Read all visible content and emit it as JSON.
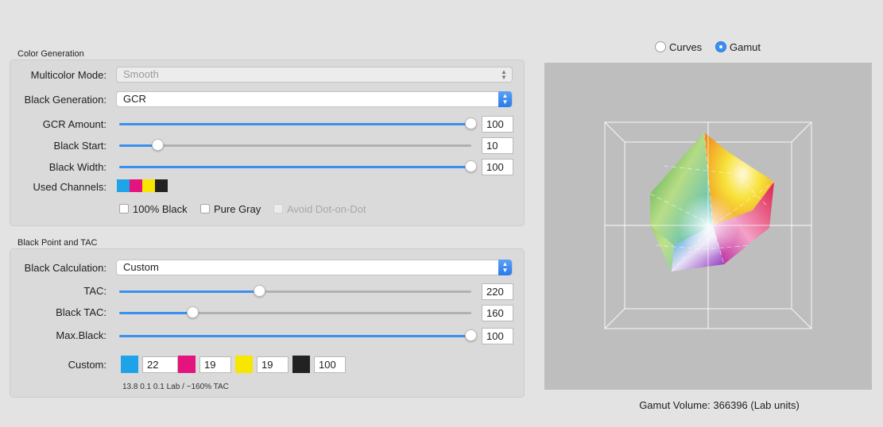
{
  "color_generation": {
    "title": "Color Generation",
    "multicolor_mode": {
      "label": "Multicolor Mode:",
      "value": "Smooth"
    },
    "black_generation": {
      "label": "Black Generation:",
      "value": "GCR"
    },
    "gcr_amount": {
      "label": "GCR Amount:",
      "value": "100",
      "fraction": 1.0
    },
    "black_start": {
      "label": "Black Start:",
      "value": "10",
      "fraction": 0.11
    },
    "black_width": {
      "label": "Black Width:",
      "value": "100",
      "fraction": 1.0
    },
    "used_channels": {
      "label": "Used Channels:",
      "colors": [
        "#1fa3e8",
        "#e5137d",
        "#f7e600",
        "#222222"
      ]
    },
    "options": {
      "black100": "100% Black",
      "pure_gray": "Pure Gray",
      "avoid_dot": "Avoid Dot-on-Dot"
    }
  },
  "black_point": {
    "title": "Black Point and TAC",
    "black_calculation": {
      "label": "Black Calculation:",
      "value": "Custom"
    },
    "tac": {
      "label": "TAC:",
      "value": "220",
      "fraction": 0.4
    },
    "black_tac": {
      "label": "Black TAC:",
      "value": "160",
      "fraction": 0.21
    },
    "max_black": {
      "label": "Max.Black:",
      "value": "100",
      "fraction": 1.0
    },
    "custom": {
      "label": "Custom:",
      "c": "22",
      "m": "19",
      "y": "19",
      "k": "100",
      "colors": [
        "#1fa3e8",
        "#e5137d",
        "#f7e600",
        "#222222"
      ]
    },
    "info": "13.8 0.1 0.1 Lab / ~160% TAC"
  },
  "view": {
    "curves": "Curves",
    "gamut": "Gamut",
    "selected": "Gamut",
    "volume_text": "Gamut Volume: 366396 (Lab units)"
  }
}
